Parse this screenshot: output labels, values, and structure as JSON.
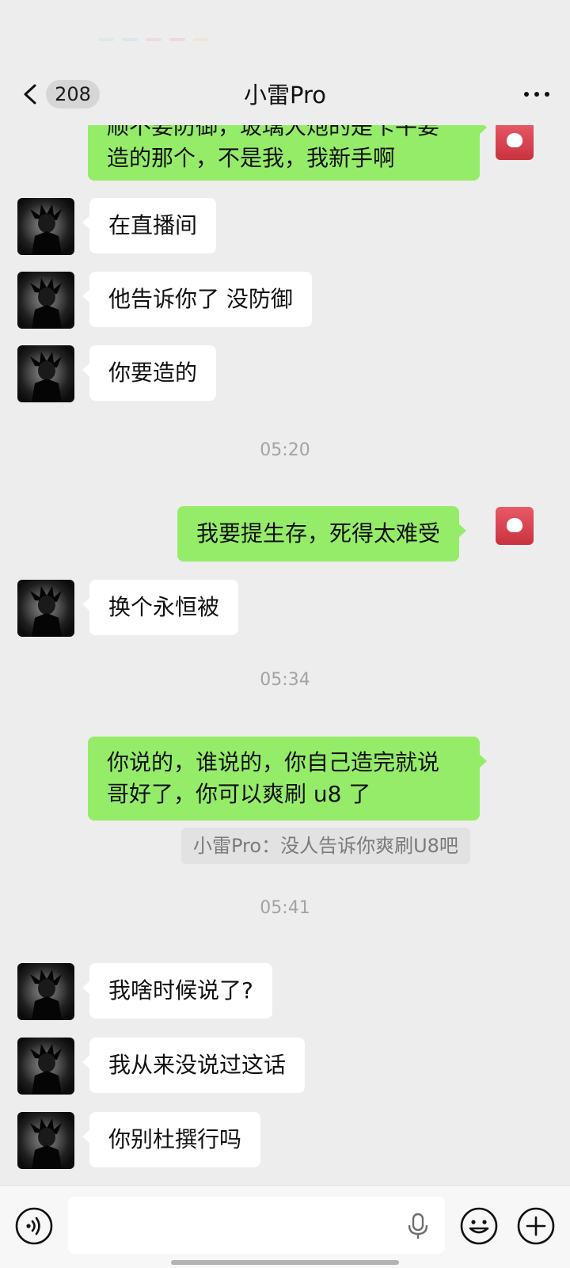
{
  "status_bar": {
    "colors": [
      "#b9e7d8",
      "#b9d6ee",
      "#f0b8c6",
      "#f1b4b4",
      "#eedbae"
    ]
  },
  "nav": {
    "back_icon": "chevron-left-icon",
    "unread_count": "208",
    "title": "小雷Pro",
    "more_icon": "more-dots-icon"
  },
  "messages": {
    "m1": {
      "side": "out",
      "line1": "顺不要防御，玻璃大炮的是卡牛要",
      "line2": "造的那个，不是我，我新手啊"
    },
    "m2": {
      "side": "in",
      "text": "在直播间"
    },
    "m3": {
      "side": "in",
      "text": "他告诉你了 没防御"
    },
    "m4": {
      "side": "in",
      "text": "你要造的"
    },
    "t1": "05:20",
    "m5": {
      "side": "out",
      "text": "我要提生存，死得太难受"
    },
    "m6": {
      "side": "in",
      "text": "换个永恒被"
    },
    "t2": "05:34",
    "m7": {
      "side": "out",
      "line1": "你说的，谁说的，你自己造完就说",
      "line2": "哥好了，你可以爽刷 u8 了"
    },
    "m7_quote": "小雷Pro：没人告诉你爽刷U8吧",
    "t3": "05:41",
    "m8": {
      "side": "in",
      "text": "我啥时候说了?"
    },
    "m9": {
      "side": "in",
      "text": "我从来没说过这话"
    },
    "m10": {
      "side": "in",
      "text": "你别杜撰行吗"
    }
  },
  "input_bar": {
    "voice_icon": "voice-icon",
    "mic_icon": "microphone-icon",
    "emoji_icon": "emoji-icon",
    "plus_icon": "plus-icon",
    "input_value": ""
  },
  "colors": {
    "background": "#ededed",
    "incoming_bubble": "#ffffff",
    "outgoing_bubble": "#95ec69",
    "timestamp": "#a3a3a3"
  }
}
